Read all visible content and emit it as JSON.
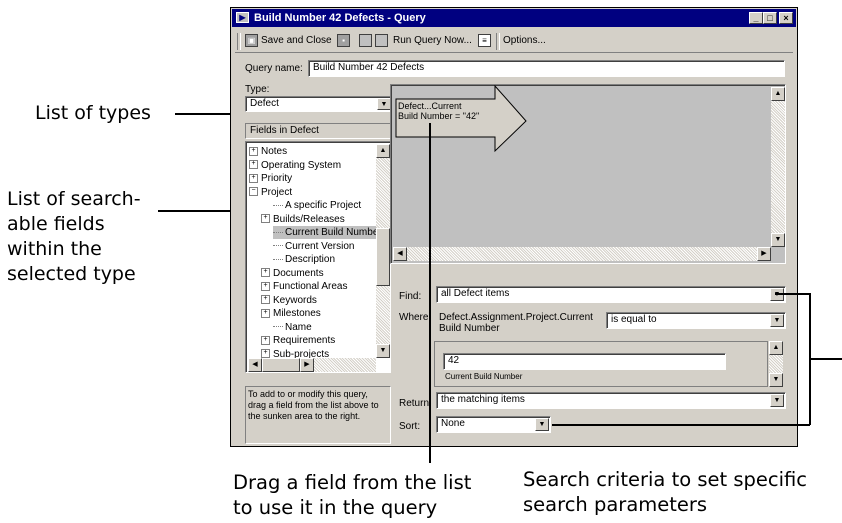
{
  "window": {
    "title": "Build Number 42 Defects - Query",
    "min_btn": "_",
    "max_btn": "□",
    "close_btn": "×"
  },
  "toolbar": {
    "save_close": "Save and Close",
    "run_query": "Run Query Now...",
    "options": "Options..."
  },
  "query": {
    "name_label": "Query name:",
    "name_value": "Build Number 42 Defects",
    "type_label": "Type:",
    "type_value": "Defect",
    "fields_label": "Fields in Defect"
  },
  "tree": {
    "items": [
      {
        "label": "Notes",
        "prefix": "+"
      },
      {
        "label": "Operating System",
        "prefix": "+"
      },
      {
        "label": "Priority",
        "prefix": "+"
      },
      {
        "label": "Project",
        "prefix": "−"
      },
      {
        "label": "A specific Project",
        "prefix": ""
      },
      {
        "label": "Builds/Releases",
        "prefix": "+"
      },
      {
        "label": "Current Build Number",
        "prefix": ""
      },
      {
        "label": "Current Version",
        "prefix": ""
      },
      {
        "label": "Description",
        "prefix": ""
      },
      {
        "label": "Documents",
        "prefix": "+"
      },
      {
        "label": "Functional Areas",
        "prefix": "+"
      },
      {
        "label": "Keywords",
        "prefix": "+"
      },
      {
        "label": "Milestones",
        "prefix": "+"
      },
      {
        "label": "Name",
        "prefix": ""
      },
      {
        "label": "Requirements",
        "prefix": "+"
      },
      {
        "label": "Sub-projects",
        "prefix": "+"
      }
    ],
    "selected_index": 6
  },
  "help_text": "To add to or modify this query, drag a field from the list above to the sunken area to the right.",
  "arrow": {
    "line1": "Defect...Current",
    "line2": "Build Number  = \"42\""
  },
  "criteria": {
    "find_label": "Find:",
    "find_value": "all Defect items",
    "where_label": "Where:",
    "where_field": "Defect.Assignment.Project.Current Build Number",
    "where_operator": "is equal to",
    "value": "42",
    "value_caption": "Current Build Number",
    "return_label": "Return:",
    "return_value": "the matching items",
    "sort_label": "Sort:",
    "sort_value": "None"
  },
  "annotations": {
    "list_of_types": "List of types",
    "searchable_line1": "List of search-",
    "searchable_line2": "able fields",
    "searchable_line3": "within the",
    "searchable_line4": "selected type",
    "drag_line1": "Drag a field from the list",
    "drag_line2": "to use it in the query",
    "criteria_line1": "Search criteria to set specific",
    "criteria_line2": "search parameters"
  }
}
